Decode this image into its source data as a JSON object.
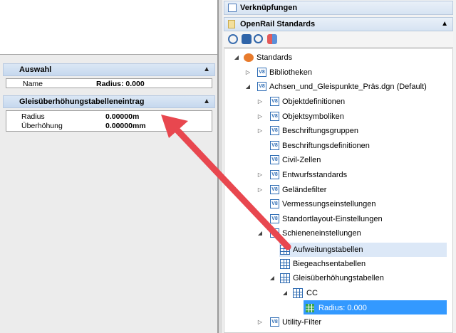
{
  "left_panel": {
    "auswahl": {
      "title": "Auswahl",
      "rows": [
        {
          "key": "Name",
          "value": "Radius: 0.000"
        }
      ]
    },
    "gleis": {
      "title": "Gleisüberhöhungstabelleneintrag",
      "rows": [
        {
          "key": "Radius",
          "value": "0.00000m"
        },
        {
          "key": "Überhöhung",
          "value": "0.00000mm"
        }
      ]
    }
  },
  "right_panel": {
    "verknuepfungen_title": "Verknüpfungen",
    "openrail_title": "OpenRail Standards",
    "toolbar": [
      "refresh-icon",
      "library-icon",
      "zoom-icon",
      "grid-small-icon"
    ],
    "tree": [
      {
        "label": "Standards",
        "expander": "◢"
      },
      {
        "label": "Bibliotheken",
        "expander": "▷"
      },
      {
        "label": "Achsen_und_Gleispunkte_Präs.dgn (Default)",
        "expander": "◢"
      },
      {
        "label": "Objektdefinitionen",
        "expander": "▷"
      },
      {
        "label": "Objektsymboliken",
        "expander": "▷"
      },
      {
        "label": "Beschriftungsgruppen",
        "expander": "▷"
      },
      {
        "label": "Beschriftungsdefinitionen",
        "expander": ""
      },
      {
        "label": "Civil-Zellen",
        "expander": ""
      },
      {
        "label": "Entwurfsstandards",
        "expander": "▷"
      },
      {
        "label": "Geländefilter",
        "expander": "▷"
      },
      {
        "label": "Vermessungseinstellungen",
        "expander": ""
      },
      {
        "label": "Standortlayout-Einstellungen",
        "expander": ""
      },
      {
        "label": "Schieneneinstellungen",
        "expander": "◢"
      },
      {
        "label": "Aufweitungstabellen",
        "expander": ""
      },
      {
        "label": "Biegeachsentabellen",
        "expander": ""
      },
      {
        "label": "Gleisüberhöhungstabellen",
        "expander": "◢"
      },
      {
        "label": "CC",
        "expander": "◢"
      },
      {
        "label": "Radius: 0.000",
        "expander": ""
      },
      {
        "label": "Utility-Filter",
        "expander": "▷"
      }
    ]
  },
  "colors": {
    "selection": "#3399ff",
    "hover": "#dce8f7",
    "arrow": "#e8474f"
  }
}
